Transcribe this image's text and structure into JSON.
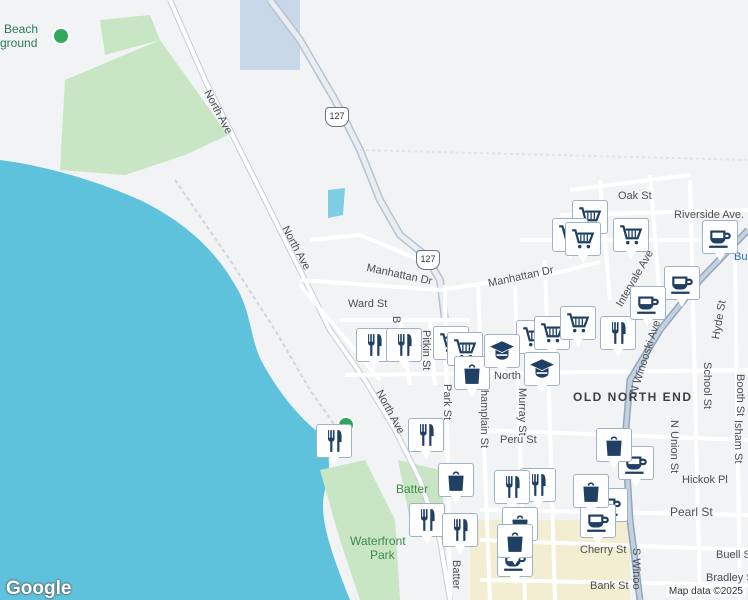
{
  "map": {
    "attribution": "Map data ©2025",
    "logo": "Google",
    "colors": {
      "water": "#5fc2dd",
      "land": "#f2f3f4",
      "park": "#c8e6c3",
      "road": "#ffffff",
      "highway": "#b8c3cf",
      "marker_icon": "#1f3f63"
    }
  },
  "labels": {
    "beach": "Beach",
    "ground": "ground",
    "north_ave_1": "North Ave",
    "north_ave_2": "North Ave",
    "north_ave_3": "North Ave",
    "route_127_a": "127",
    "route_127_b": "127",
    "manhattan_dr_1": "Manhattan Dr",
    "manhattan_dr_2": "Manhattan Dr",
    "ward_st": "Ward St",
    "b_st": "B",
    "pitkin_st": "Pitkin St",
    "park_st": "Park St",
    "champlain_st": "Champlain St",
    "murray_st": "Murray St",
    "north_st": "North",
    "old_north_end": "OLD NORTH END",
    "peru_st": "Peru St",
    "oak_st": "Oak St",
    "riverside_ave": "Riverside Ave.",
    "intervale_ave": "Intervale Ave",
    "n_winooski_ave": "N Winooski Ave",
    "hyde_st": "Hyde St",
    "school_st": "School St",
    "booth_st": "Booth St",
    "isham_st": "Isham St",
    "n_union_st": "N Union St",
    "hickok_pl": "Hickok Pl",
    "pearl_st": "Pearl St",
    "cherry_st": "Cherry St",
    "buell_st": "Buell S",
    "bradley_st": "Bradley S",
    "bank_st": "Bank St",
    "s_winooski": "S Winoo",
    "battery_1": "Batter",
    "battery_2": "Batter",
    "waterfront_park_1": "Waterfront",
    "waterfront_park_2": "Park",
    "bu": "Bu"
  },
  "markers": [
    {
      "id": "restaurant-marker-1",
      "icon": "restaurant-icon"
    },
    {
      "id": "restaurant-marker-2",
      "icon": "restaurant-icon"
    },
    {
      "id": "restaurant-marker-3",
      "icon": "restaurant-icon"
    },
    {
      "id": "restaurant-marker-4",
      "icon": "restaurant-icon"
    },
    {
      "id": "restaurant-marker-5",
      "icon": "restaurant-icon"
    },
    {
      "id": "restaurant-marker-6",
      "icon": "restaurant-icon"
    },
    {
      "id": "restaurant-marker-7",
      "icon": "restaurant-icon"
    },
    {
      "id": "restaurant-marker-8",
      "icon": "restaurant-icon"
    },
    {
      "id": "restaurant-marker-9",
      "icon": "restaurant-icon"
    },
    {
      "id": "grocery-marker-1",
      "icon": "shopping-cart-icon"
    },
    {
      "id": "grocery-marker-2",
      "icon": "shopping-cart-icon"
    },
    {
      "id": "grocery-marker-3",
      "icon": "shopping-cart-icon"
    },
    {
      "id": "grocery-marker-4",
      "icon": "shopping-cart-icon"
    },
    {
      "id": "grocery-marker-5",
      "icon": "shopping-cart-icon"
    },
    {
      "id": "grocery-marker-6",
      "icon": "shopping-cart-icon"
    },
    {
      "id": "grocery-marker-7",
      "icon": "shopping-cart-icon"
    },
    {
      "id": "grocery-marker-8",
      "icon": "shopping-cart-icon"
    },
    {
      "id": "grocery-marker-9",
      "icon": "shopping-cart-icon"
    },
    {
      "id": "cafe-marker-1",
      "icon": "coffee-cup-icon"
    },
    {
      "id": "cafe-marker-2",
      "icon": "coffee-cup-icon"
    },
    {
      "id": "cafe-marker-3",
      "icon": "coffee-cup-icon"
    },
    {
      "id": "cafe-marker-4",
      "icon": "coffee-cup-icon"
    },
    {
      "id": "cafe-marker-5",
      "icon": "coffee-cup-icon"
    },
    {
      "id": "cafe-marker-6",
      "icon": "coffee-cup-icon"
    },
    {
      "id": "cafe-marker-7",
      "icon": "coffee-cup-icon"
    },
    {
      "id": "shop-marker-1",
      "icon": "shopping-bag-icon"
    },
    {
      "id": "shop-marker-2",
      "icon": "shopping-bag-icon"
    },
    {
      "id": "shop-marker-3",
      "icon": "shopping-bag-icon"
    },
    {
      "id": "shop-marker-4",
      "icon": "shopping-bag-icon"
    },
    {
      "id": "shop-marker-5",
      "icon": "shopping-bag-icon"
    },
    {
      "id": "shop-marker-6",
      "icon": "shopping-bag-icon"
    },
    {
      "id": "school-marker-1",
      "icon": "graduation-cap-icon"
    },
    {
      "id": "school-marker-2",
      "icon": "graduation-cap-icon"
    }
  ]
}
